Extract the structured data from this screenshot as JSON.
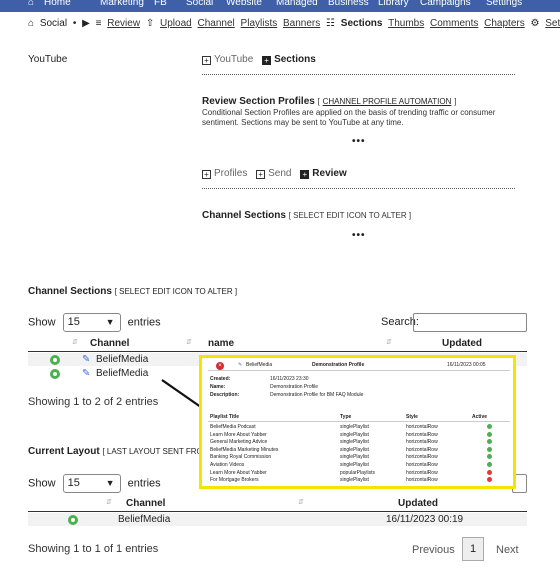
{
  "top_nav": [
    "Home",
    "Marketing",
    "FB",
    "Social",
    "Website",
    "Managed",
    "Business",
    "Library",
    "Campaigns",
    "Settings"
  ],
  "tab_bar": {
    "home_icon": "home-icon",
    "social": "Social",
    "bullet": "•",
    "youtube_icon": "youtube-icon",
    "list_icon": "list-icon",
    "review": "Review",
    "upload_icon": "upload-icon",
    "upload": "Upload",
    "channel": "Channel",
    "playlists": "Playlists",
    "banners": "Banners",
    "sections_icon": "sitemap-icon",
    "sections": "Sections",
    "thumbs": "Thumbs",
    "comments": "Comments",
    "chapters": "Chapters",
    "settings_icon": "gear-icon",
    "settings": "Settings"
  },
  "left_title": "YouTube",
  "top_tabs": {
    "youtube": "YouTube",
    "sections": "Sections"
  },
  "review_section": {
    "title": "Review Section Profiles",
    "bracket_open": "[",
    "link": "CHANNEL PROFILE AUTOMATION",
    "bracket_close": "]",
    "description": "Conditional Section Profiles are applied on the basis of trending traffic or consumer sentiment. Sections may be sent to YouTube at any time.",
    "more": "•••"
  },
  "sub_tabs": {
    "profiles": "Profiles",
    "send": "Send",
    "review": "Review"
  },
  "channel_sections_block": {
    "title": "Channel Sections",
    "hint": "[ SELECT EDIT ICON TO ALTER ]",
    "more": "•••"
  },
  "channel_sections_table": {
    "title": "Channel Sections",
    "hint": "[ SELECT EDIT ICON TO ALTER ]",
    "show_label": "Show",
    "entries_value": "15",
    "entries_label": "entries",
    "search_label": "Search:",
    "columns": {
      "channel": "Channel",
      "name": "name",
      "updated": "Updated"
    },
    "rows": [
      {
        "channel": "BeliefMedia"
      },
      {
        "channel": "BeliefMedia"
      }
    ],
    "info": "Showing 1 to 2 of 2 entries",
    "pager_partial": "t"
  },
  "current_layout": {
    "title": "Current Layout",
    "hint": "[ LAST LAYOUT SENT FROM YA",
    "show_label": "Show",
    "entries_value": "15",
    "entries_label": "entries",
    "columns": {
      "channel": "Channel",
      "updated": "Updated"
    },
    "rows": [
      {
        "channel": "BeliefMedia",
        "updated": "16/11/2023 00:19"
      }
    ],
    "info": "Showing 1 to 1 of 1 entries",
    "previous": "Previous",
    "page": "1",
    "next": "Next"
  },
  "popup": {
    "close": "×",
    "edit_label": "BeliefMedia",
    "title": "Demonstration Profile",
    "date": "16/11/2023 00:05",
    "fields": [
      {
        "label": "Created:",
        "value": "16/11/2023 23:30"
      },
      {
        "label": "Name:",
        "value": "Demonstration Profile"
      },
      {
        "label": "Description:",
        "value": "Demonstration Profile for BM FAQ Module"
      }
    ],
    "headers": {
      "title": "Playlist Title",
      "type": "Type",
      "style": "Style",
      "active": "Active"
    },
    "rows": [
      {
        "title": "BeliefMedia Podcast",
        "type": "singlePlaylist",
        "style": "horizontalRow",
        "active": true
      },
      {
        "title": "Learn More About Yabber",
        "type": "singlePlaylist",
        "style": "horizontalRow",
        "active": true
      },
      {
        "title": "General Marketing Advice",
        "type": "singlePlaylist",
        "style": "horizontalRow",
        "active": true
      },
      {
        "title": "BeliefMedia Marketing Minutes",
        "type": "singlePlaylist",
        "style": "horizontalRow",
        "active": true
      },
      {
        "title": "Banking Royal Commission",
        "type": "singlePlaylist",
        "style": "horizontalRow",
        "active": true
      },
      {
        "title": "Aviation Videos",
        "type": "singlePlaylist",
        "style": "horizontalRow",
        "active": true
      },
      {
        "title": "Learn More About Yabber",
        "type": "popularPlaylists",
        "style": "horizontalRow",
        "active": false
      },
      {
        "title": "For Mortgage Brokers",
        "type": "singlePlaylist",
        "style": "horizontalRow",
        "active": false
      }
    ]
  },
  "colors": {
    "nav_bg": "#3f5fa8",
    "highlight_border": "#f5e400",
    "active_green": "#4caf50",
    "inactive_red": "#e53935",
    "link_blue": "#3a6fd8"
  }
}
